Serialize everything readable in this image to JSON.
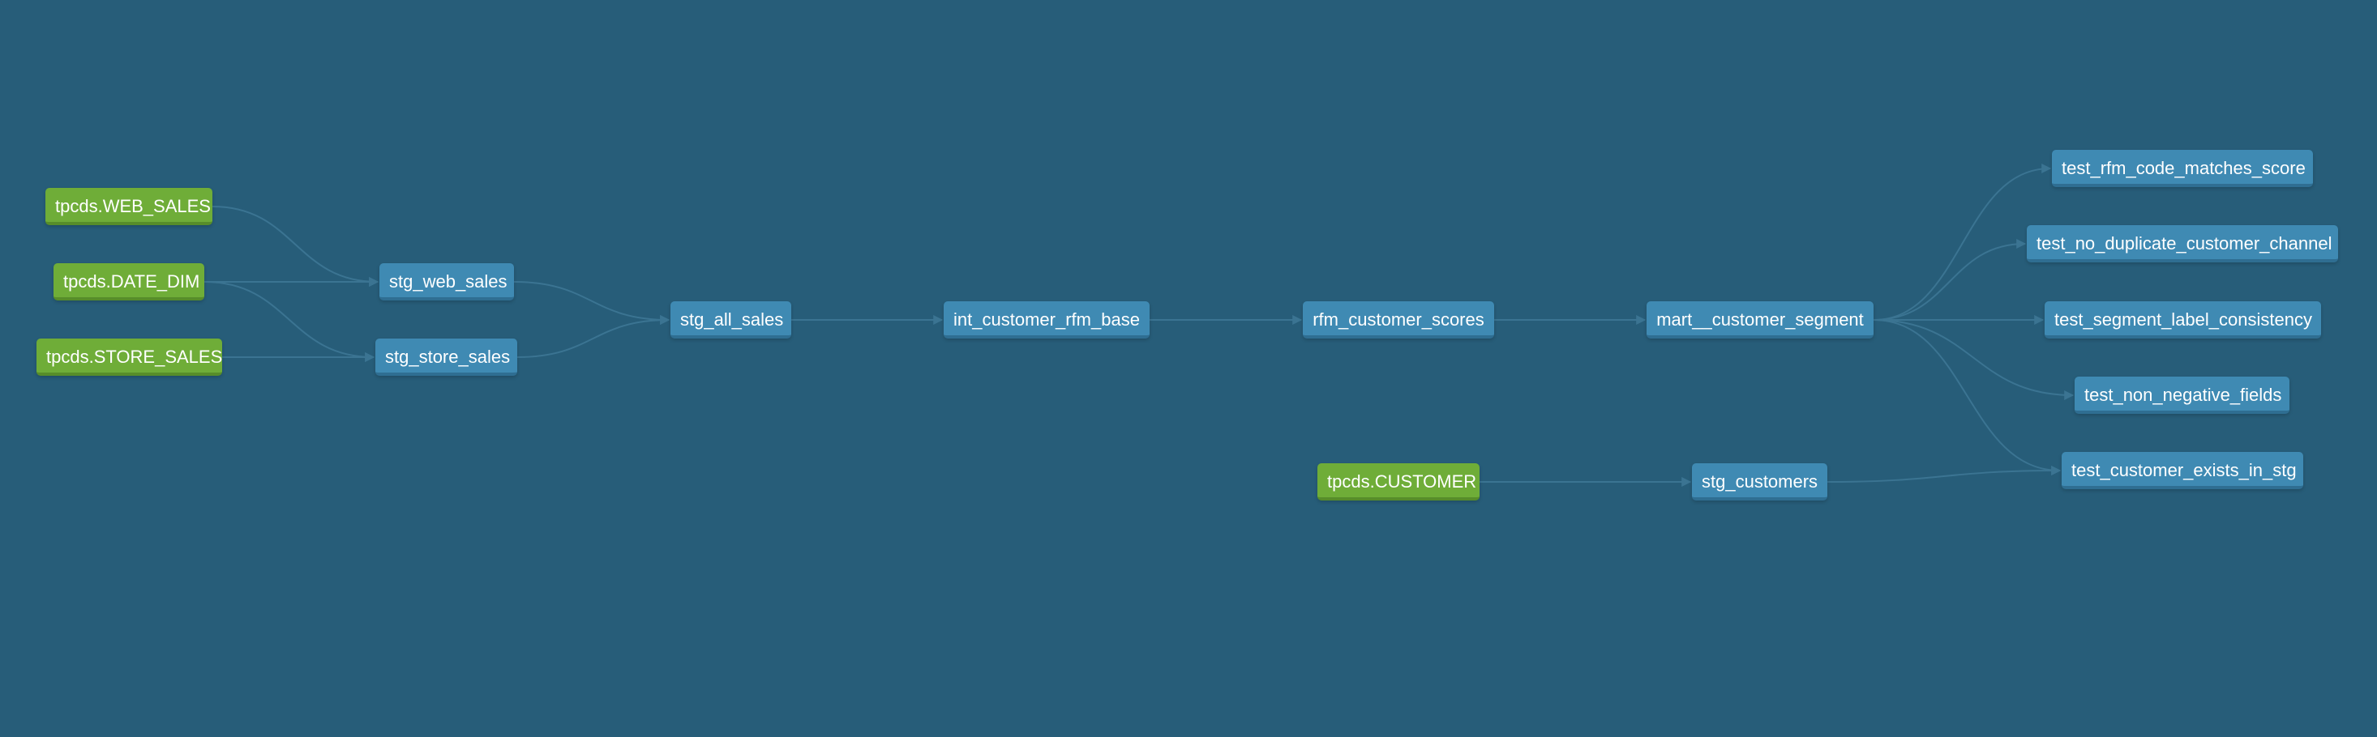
{
  "colors": {
    "background": "#275d79",
    "model_node": "#3f8ab3",
    "source_node": "#6fad38",
    "edge": "#3b7492"
  },
  "nodes": {
    "src_web_sales": "tpcds.WEB_SALES",
    "src_date_dim": "tpcds.DATE_DIM",
    "src_store_sales": "tpcds.STORE_SALES",
    "stg_web_sales": "stg_web_sales",
    "stg_store_sales": "stg_store_sales",
    "stg_all_sales": "stg_all_sales",
    "int_customer_rfm_base": "int_customer_rfm_base",
    "rfm_customer_scores": "rfm_customer_scores",
    "mart_customer_segment": "mart__customer_segment",
    "test_rfm_code": "test_rfm_code_matches_score",
    "test_no_dup": "test_no_duplicate_customer_channel",
    "test_segment_label": "test_segment_label_consistency",
    "test_non_negative": "test_non_negative_fields",
    "test_customer_exists": "test_customer_exists_in_stg",
    "src_customer": "tpcds.CUSTOMER",
    "stg_customers": "stg_customers"
  },
  "edges": [
    [
      "src_web_sales",
      "stg_web_sales"
    ],
    [
      "src_date_dim",
      "stg_web_sales"
    ],
    [
      "src_date_dim",
      "stg_store_sales"
    ],
    [
      "src_store_sales",
      "stg_store_sales"
    ],
    [
      "stg_web_sales",
      "stg_all_sales"
    ],
    [
      "stg_store_sales",
      "stg_all_sales"
    ],
    [
      "stg_all_sales",
      "int_customer_rfm_base"
    ],
    [
      "int_customer_rfm_base",
      "rfm_customer_scores"
    ],
    [
      "rfm_customer_scores",
      "mart_customer_segment"
    ],
    [
      "mart_customer_segment",
      "test_rfm_code"
    ],
    [
      "mart_customer_segment",
      "test_no_dup"
    ],
    [
      "mart_customer_segment",
      "test_segment_label"
    ],
    [
      "mart_customer_segment",
      "test_non_negative"
    ],
    [
      "mart_customer_segment",
      "test_customer_exists"
    ],
    [
      "src_customer",
      "stg_customers"
    ],
    [
      "stg_customers",
      "test_customer_exists"
    ]
  ]
}
